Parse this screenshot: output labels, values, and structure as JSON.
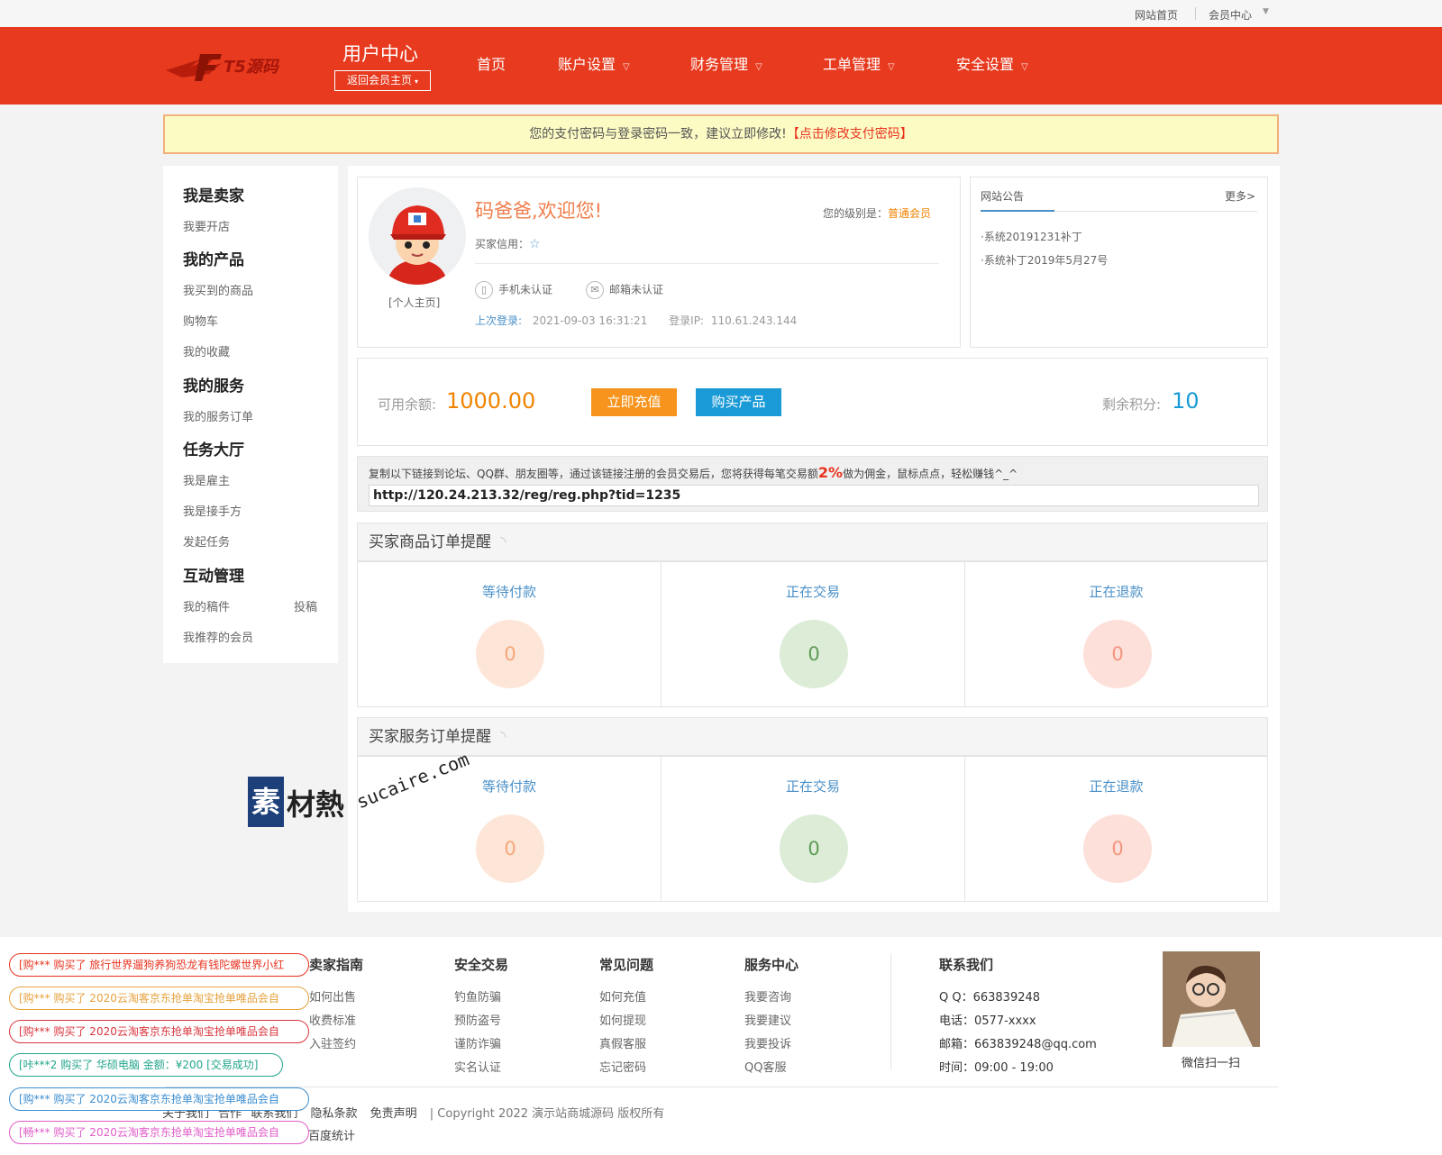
{
  "topbar": {
    "links": [
      "网站首页",
      "会员中心"
    ]
  },
  "header": {
    "logo_text": "T5源码",
    "title": "用户中心",
    "back_button": "返回会员主页",
    "nav": [
      "首页",
      "账户设置",
      "财务管理",
      "工单管理",
      "安全设置"
    ]
  },
  "notice": {
    "text": "您的支付密码与登录密码一致，建议立即修改!",
    "link": "【点击修改支付密码】"
  },
  "sidebar": {
    "sections": [
      {
        "title": "我是卖家",
        "items": [
          "我要开店"
        ]
      },
      {
        "title": "我的产品",
        "items": [
          "我买到的商品",
          "购物车",
          "我的收藏"
        ]
      },
      {
        "title": "我的服务",
        "items": [
          "我的服务订单"
        ]
      },
      {
        "title": "任务大厅",
        "items": [
          "我是雇主",
          "我是接手方",
          "发起任务"
        ]
      },
      {
        "title": "互动管理",
        "items": [
          "我的稿件",
          "投稿",
          "我推荐的会员"
        ]
      }
    ]
  },
  "profile": {
    "welcome": "码爸爸,欢迎您!",
    "homepage_link": "[个人主页]",
    "level_label": "您的级别是：",
    "level": "普通会员",
    "credit_label": "买家信用：",
    "phone": "手机未认证",
    "email": "邮箱未认证",
    "last_login_label": "上次登录:",
    "last_login": "2021-09-03 16:31:21",
    "ip_label": "登录IP:",
    "ip": "110.61.243.144"
  },
  "announcement": {
    "title": "网站公告",
    "more": "更多>",
    "items": [
      "·系统20191231补丁",
      "·系统补丁2019年5月27号"
    ]
  },
  "balance": {
    "label": "可用余额:",
    "value": "1000.00",
    "recharge": "立即充值",
    "buy": "购买产品",
    "points_label": "剩余积分:",
    "points": "10"
  },
  "referral": {
    "text_a": "复制以下链接到论坛、QQ群、朋友圈等，通过该链接注册的会员交易后，您将获得每笔交易额",
    "percent": "2%",
    "text_b": "做为佣金，鼠标点点，轻松赚钱^_^",
    "url": "http://120.24.213.32/reg/reg.php?tid=1235"
  },
  "goods_orders": {
    "title": "买家商品订单提醒",
    "cells": [
      {
        "label": "等待付款",
        "count": "0"
      },
      {
        "label": "正在交易",
        "count": "0"
      },
      {
        "label": "正在退款",
        "count": "0"
      }
    ]
  },
  "service_orders": {
    "title": "买家服务订单提醒",
    "cells": [
      {
        "label": "等待付款",
        "count": "0"
      },
      {
        "label": "正在交易",
        "count": "0"
      },
      {
        "label": "正在退款",
        "count": "0"
      }
    ]
  },
  "watermark": {
    "text": "素材熱",
    "url": "sucaire.com"
  },
  "footer": {
    "columns": [
      {
        "title": "卖家指南",
        "items": [
          "如何出售",
          "收费标准",
          "入驻签约"
        ]
      },
      {
        "title": "安全交易",
        "items": [
          "钓鱼防骗",
          "预防盗号",
          "谨防诈骗",
          "实名认证"
        ]
      },
      {
        "title": "常见问题",
        "items": [
          "如何充值",
          "如何提现",
          "真假客服",
          "忘记密码"
        ]
      },
      {
        "title": "服务中心",
        "items": [
          "我要咨询",
          "我要建议",
          "我要投诉",
          "QQ客服"
        ]
      }
    ],
    "contact": {
      "title": "联系我们",
      "qq": "Q Q：663839248",
      "phone": "电话：0577-xxxx",
      "email": "邮箱：663839248@qq.com",
      "hours": "时间：09:00 - 19:00"
    },
    "qr_caption": "微信扫一扫",
    "links": [
      "关于我们",
      "合作",
      "联系我们",
      "隐私条款",
      "免责声明"
    ],
    "copyright": "| Copyright 2022 演示站商城源码 版权所有",
    "stats": "百度统计"
  },
  "tickers": [
    {
      "text": "[购*** 购买了 旅行世界遛狗养狗恐龙有钱陀螺世界小红",
      "color": "#e8331f"
    },
    {
      "text": "[购*** 购买了 2020云淘客京东抢单淘宝抢单唯品会自",
      "color": "#e6a23c"
    },
    {
      "text": "[购*** 购买了 2020云淘客京东抢单淘宝抢单唯品会自",
      "color": "#d9363e"
    },
    {
      "text": "[咔***2 购买了 华硕电脑 金额：¥200 [交易成功]",
      "color": "#22a58c"
    },
    {
      "text": "[购*** 购买了 2020云淘客京东抢单淘宝抢单唯品会自",
      "color": "#3b8ed0"
    },
    {
      "text": "[畅*** 购买了 2020云淘客京东抢单淘宝抢单唯品会自",
      "color": "#e05cc8"
    }
  ]
}
